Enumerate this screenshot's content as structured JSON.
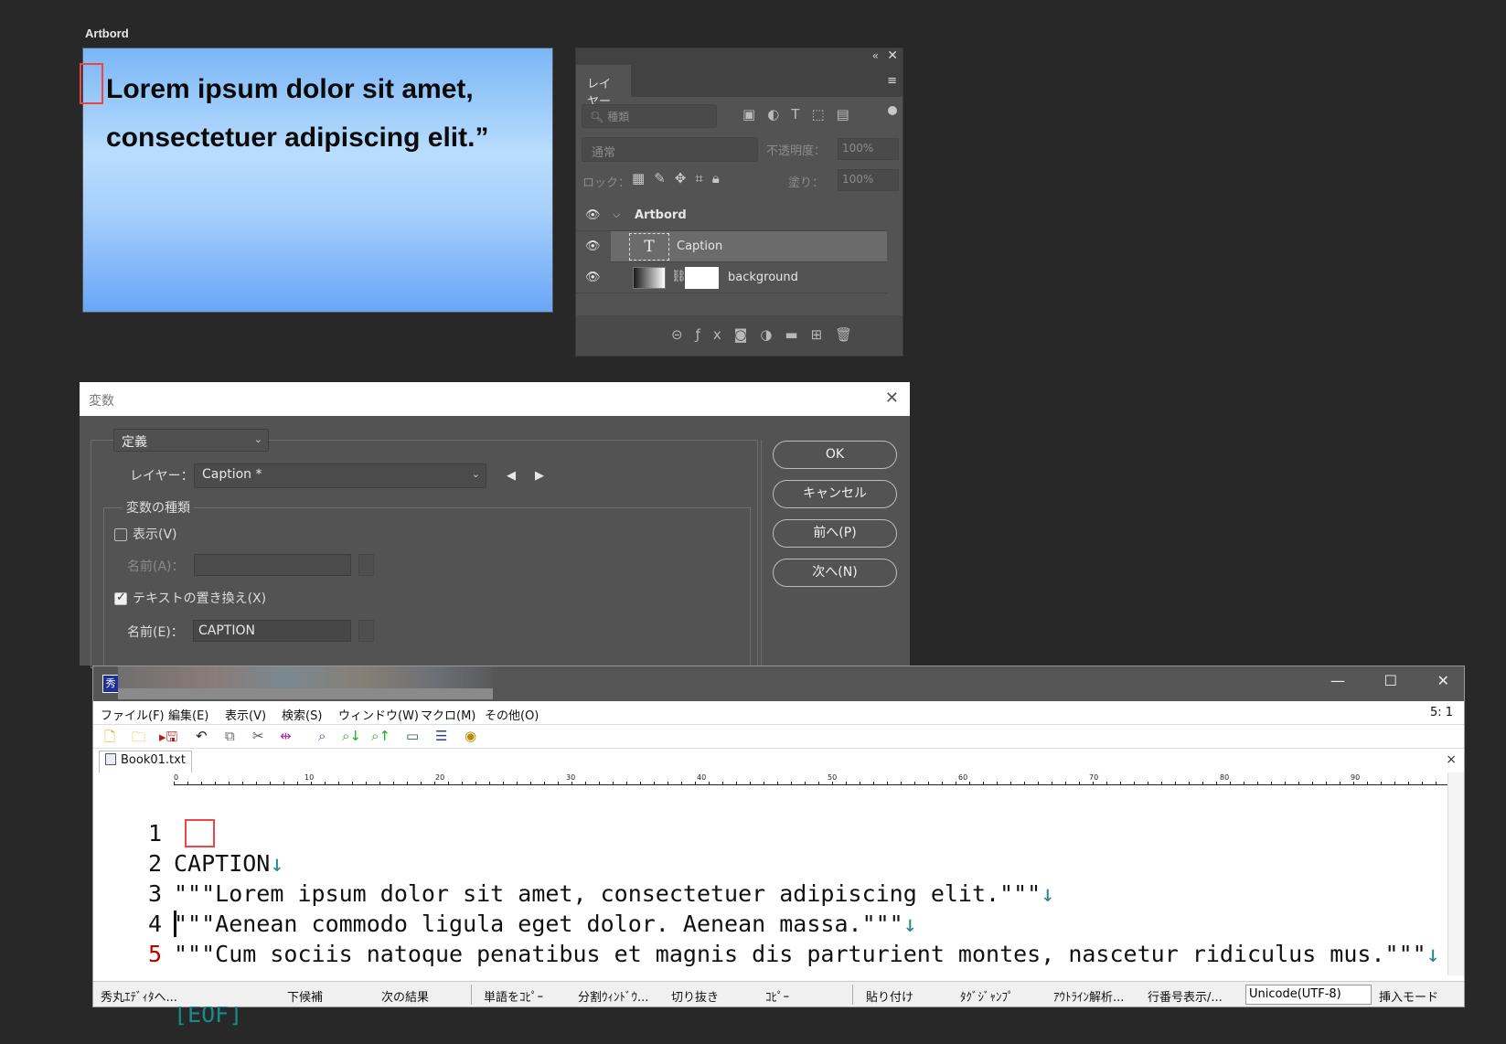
{
  "artboard": {
    "label": "Artbord",
    "text": "Lorem ipsum dolor sit amet, consectetuer adipiscing elit.”"
  },
  "layers_panel": {
    "collapse_glyph": "«",
    "close_glyph": "✕",
    "tab_label": "レイヤー",
    "menu_glyph": "≡",
    "search_placeholder": "種類",
    "blend_mode": "通常",
    "opacity_label": "不透明度：",
    "opacity_value": "100%",
    "lock_label": "ロック：",
    "fill_label": "塗り：",
    "fill_value": "100%",
    "layers": [
      {
        "name": "Artbord",
        "type": "group",
        "visible": true
      },
      {
        "name": "Caption",
        "type": "text",
        "visible": true,
        "selected": true
      },
      {
        "name": "background",
        "type": "gradient-with-mask",
        "visible": true
      }
    ]
  },
  "variables_dialog": {
    "title": "変数",
    "close_glyph": "✕",
    "define_select": "定義",
    "layer_label": "レイヤー：",
    "layer_value": "Caption *",
    "prev_arrow": "◀",
    "next_arrow": "▶",
    "var_types_label": "変数の種類",
    "visibility": {
      "label": "表示(V)",
      "checked": false
    },
    "visibility_name_label": "名前(A)：",
    "visibility_name_value": "",
    "text_replace": {
      "label": "テキストの置き換え(X)",
      "checked": true
    },
    "text_name_label": "名前(E)：",
    "text_name_value": "CAPTION",
    "buttons": {
      "ok": "OK",
      "cancel": "キャンセル",
      "prev": "前へ(P)",
      "next": "次へ(N)"
    }
  },
  "editor": {
    "app_icon": "秀",
    "window_buttons": {
      "minimize": "—",
      "maximize": "☐",
      "close": "✕"
    },
    "menus": [
      "ファイル(F)",
      "編集(E)",
      "表示(V)",
      "検索(S)",
      "ウィンドウ(W)",
      "マクロ(M)",
      "その他(O)"
    ],
    "cursor_position": "5: 1",
    "tab_name": "Book01.txt",
    "tab_close": "×",
    "ruler_numbers": [
      "0",
      "10",
      "20",
      "30",
      "40",
      "50",
      "60",
      "70",
      "80",
      "90"
    ],
    "newline_glyph": "↓",
    "lines": [
      {
        "num": "1",
        "text": "CAPTION"
      },
      {
        "num": "2",
        "text": "\"\"\"Lorem ipsum dolor sit amet, consectetuer adipiscing elit.\"\"\""
      },
      {
        "num": "3",
        "text": "\"\"\"Aenean commodo ligula eget dolor. Aenean massa.\"\"\""
      },
      {
        "num": "4",
        "text": "\"\"\"Cum sociis natoque penatibus et magnis dis parturient montes, nascetur ridiculus mus.\"\"\""
      },
      {
        "num": "5",
        "text": "[EOF]"
      }
    ],
    "status_items": [
      "秀丸ｴﾃﾞｨﾀへ...",
      "下候補",
      "次の結果",
      "単語をｺﾋﾟｰ",
      "分割ｳｨﾝﾄﾞｳ...",
      "切り抜き",
      "ｺﾋﾟｰ",
      "貼り付け",
      "ﾀｸﾞｼﾞｬﾝﾌﾟ",
      "ｱｳﾄﾗｲﾝ解析...",
      "行番号表示/..."
    ],
    "encoding": "Unicode(UTF-8)",
    "insert_mode": "挿入モード"
  }
}
